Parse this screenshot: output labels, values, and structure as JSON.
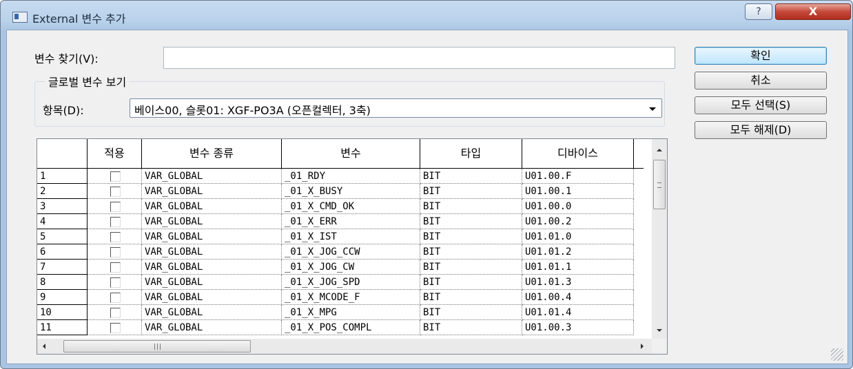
{
  "window": {
    "title": "External 변수 추가",
    "help": "?",
    "close": "X"
  },
  "search": {
    "label": "변수 찾기(V):",
    "value": ""
  },
  "group": {
    "legend": "글로벌 변수 보기",
    "item_label": "항목(D):",
    "item_value": "베이스00, 슬롯01: XGF-PO3A (오픈컬렉터, 3축)"
  },
  "buttons": {
    "ok": "확인",
    "cancel": "취소",
    "select_all": "모두 선택(S)",
    "deselect_all": "모두 해제(D)"
  },
  "table": {
    "headers": [
      "",
      "적용",
      "변수 종류",
      "변수",
      "타입",
      "디바이스"
    ],
    "rows": [
      {
        "num": "1",
        "checked": false,
        "kind": "VAR_GLOBAL",
        "var": "_01_RDY",
        "type": "BIT",
        "device": "U01.00.F"
      },
      {
        "num": "2",
        "checked": false,
        "kind": "VAR_GLOBAL",
        "var": "_01_X_BUSY",
        "type": "BIT",
        "device": "U01.00.1"
      },
      {
        "num": "3",
        "checked": false,
        "kind": "VAR_GLOBAL",
        "var": "_01_X_CMD_OK",
        "type": "BIT",
        "device": "U01.00.0"
      },
      {
        "num": "4",
        "checked": false,
        "kind": "VAR_GLOBAL",
        "var": "_01_X_ERR",
        "type": "BIT",
        "device": "U01.00.2"
      },
      {
        "num": "5",
        "checked": false,
        "kind": "VAR_GLOBAL",
        "var": "_01_X_IST",
        "type": "BIT",
        "device": "U01.01.0"
      },
      {
        "num": "6",
        "checked": false,
        "kind": "VAR_GLOBAL",
        "var": "_01_X_JOG_CCW",
        "type": "BIT",
        "device": "U01.01.2"
      },
      {
        "num": "7",
        "checked": false,
        "kind": "VAR_GLOBAL",
        "var": "_01_X_JOG_CW",
        "type": "BIT",
        "device": "U01.01.1"
      },
      {
        "num": "8",
        "checked": false,
        "kind": "VAR_GLOBAL",
        "var": "_01_X_JOG_SPD",
        "type": "BIT",
        "device": "U01.01.3"
      },
      {
        "num": "9",
        "checked": false,
        "kind": "VAR_GLOBAL",
        "var": "_01_X_MCODE_F",
        "type": "BIT",
        "device": "U01.00.4"
      },
      {
        "num": "10",
        "checked": false,
        "kind": "VAR_GLOBAL",
        "var": "_01_X_MPG",
        "type": "BIT",
        "device": "U01.01.4"
      },
      {
        "num": "11",
        "checked": false,
        "kind": "VAR_GLOBAL",
        "var": "_01_X_POS_COMPL",
        "type": "BIT",
        "device": "U01.00.3"
      }
    ]
  },
  "icons": {
    "app": "window-app-icon",
    "help": "help-icon",
    "close": "close-icon",
    "dropdown": "chevron-down-icon"
  }
}
